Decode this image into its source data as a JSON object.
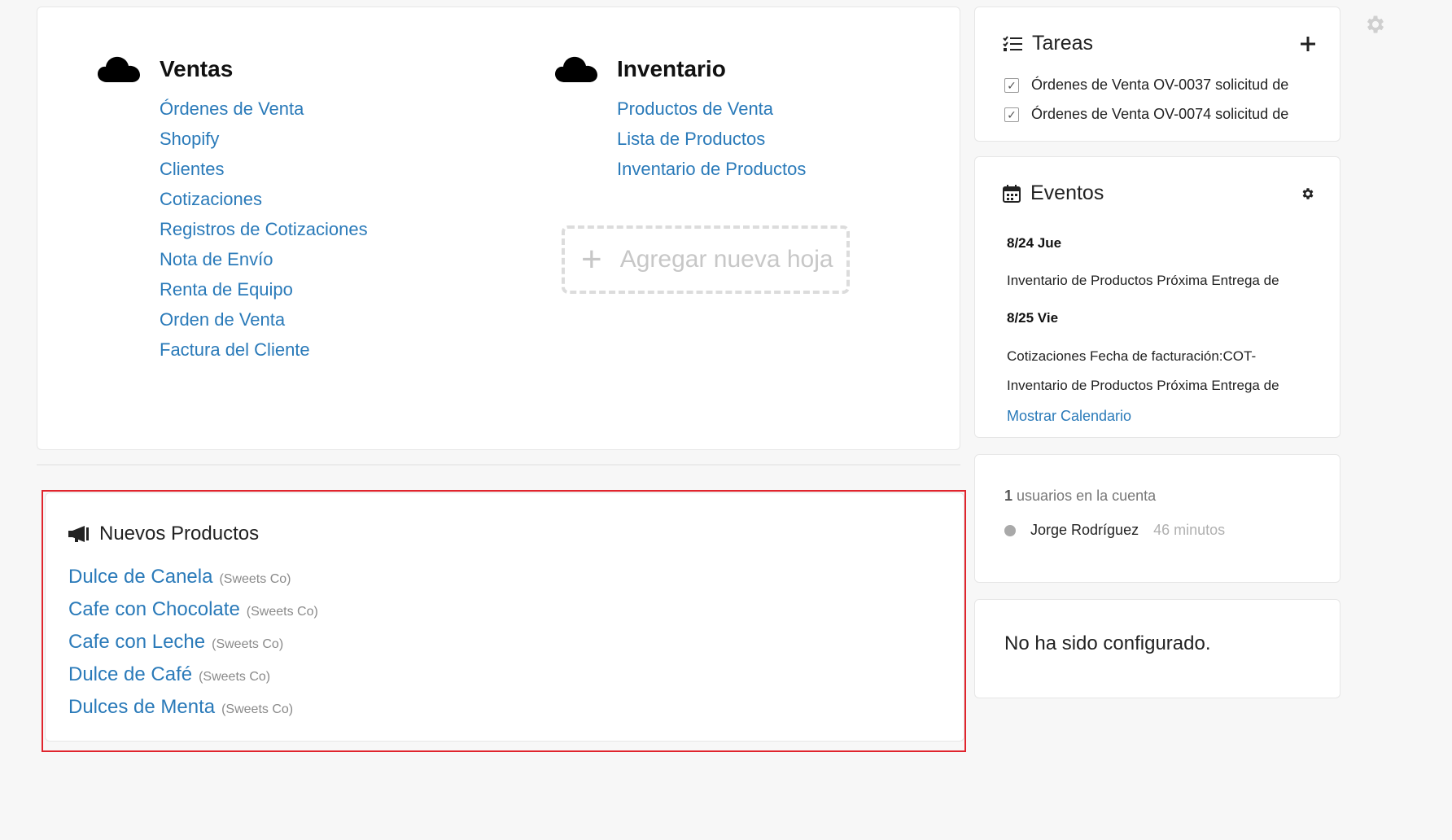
{
  "sheets": {
    "groups": [
      {
        "title": "Ventas",
        "links": [
          "Órdenes de Venta",
          "Shopify",
          "Clientes",
          "Cotizaciones",
          "Registros de Cotizaciones",
          "Nota de Envío",
          "Renta de Equipo",
          "Orden de Venta",
          "Factura del Cliente"
        ]
      },
      {
        "title": "Inventario",
        "links": [
          "Productos de Venta",
          "Lista de Productos",
          "Inventario de Productos"
        ]
      }
    ],
    "add_sheet_label": "Agregar nueva hoja"
  },
  "new_products": {
    "title": "Nuevos Productos",
    "items": [
      {
        "name": "Dulce de Canela",
        "vendor": "(Sweets Co)"
      },
      {
        "name": "Cafe con Chocolate",
        "vendor": "(Sweets Co)"
      },
      {
        "name": "Cafe con Leche",
        "vendor": "(Sweets Co)"
      },
      {
        "name": "Dulce de Café",
        "vendor": "(Sweets Co)"
      },
      {
        "name": "Dulces de Menta",
        "vendor": "(Sweets Co)"
      }
    ]
  },
  "tasks": {
    "title": "Tareas",
    "items": [
      "Órdenes de Venta OV-0037 solicitud de",
      "Órdenes de Venta OV-0074 solicitud de"
    ]
  },
  "events": {
    "title": "Eventos",
    "days": [
      {
        "date": "8/24 Jue",
        "items": [
          "Inventario de Productos Próxima Entrega de"
        ]
      },
      {
        "date": "8/25 Vie",
        "items": [
          "Cotizaciones Fecha de facturación:COT-",
          "Inventario de Productos Próxima Entrega de"
        ]
      }
    ],
    "show_calendar": "Mostrar Calendario"
  },
  "users": {
    "count": "1",
    "count_text": "usuarios en la cuenta",
    "list": [
      {
        "name": "Jorge Rodríguez",
        "time": "46 minutos"
      }
    ]
  },
  "config": {
    "message": "No ha sido configurado."
  },
  "colors": {
    "link": "#2a7ab9",
    "highlight_border": "#e0242d"
  }
}
